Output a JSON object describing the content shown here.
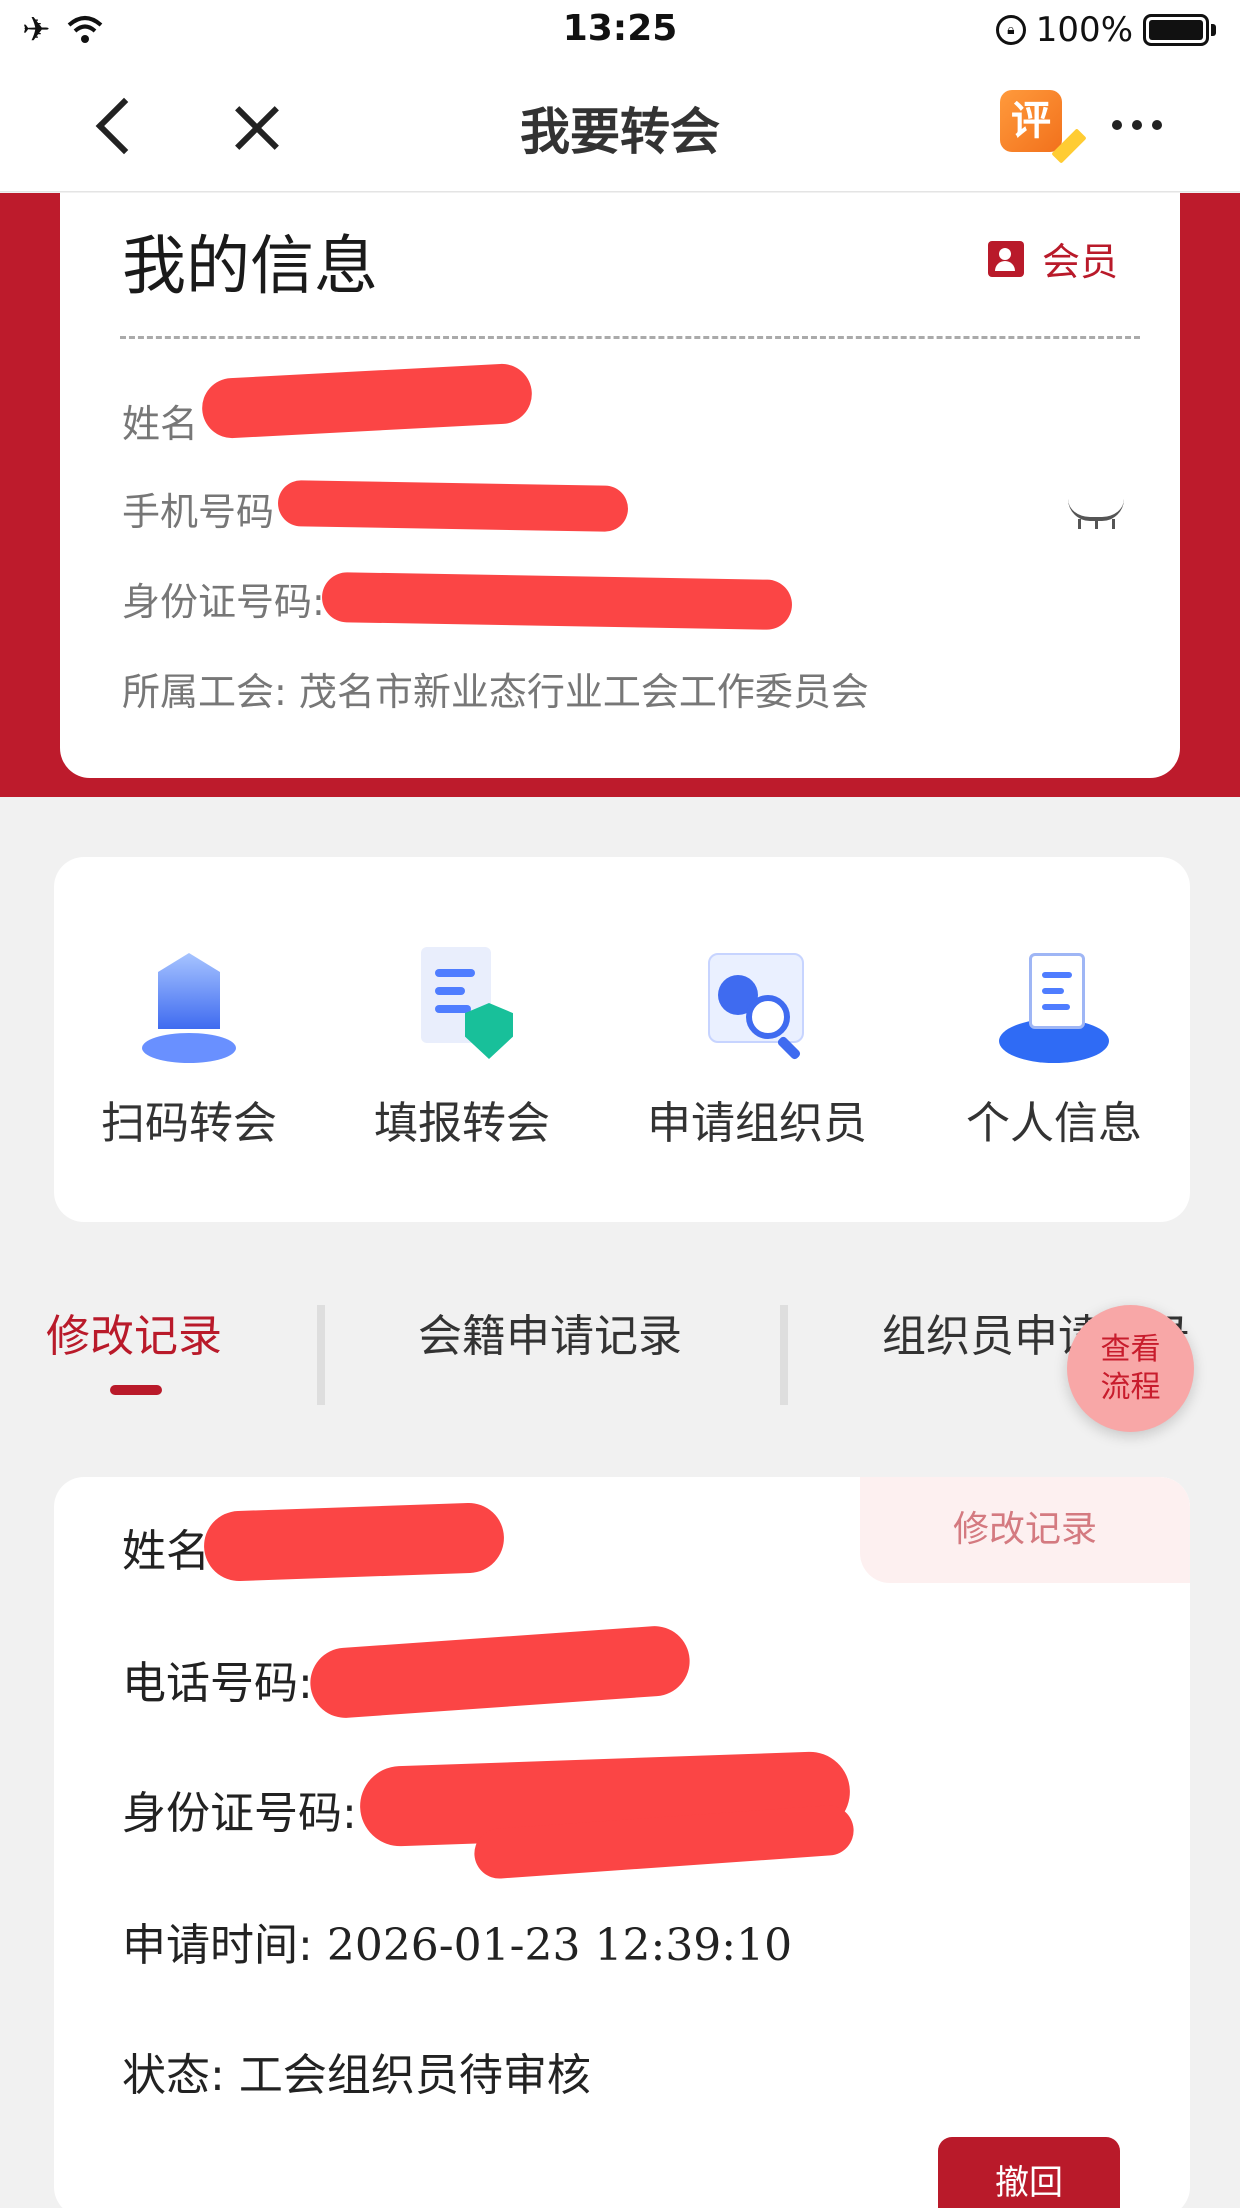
{
  "status_bar": {
    "time": "13:25",
    "battery": "100%",
    "icons": [
      "airplane-icon",
      "wifi-icon",
      "orientation-lock-icon",
      "battery-icon"
    ]
  },
  "nav": {
    "title": "我要转会",
    "rate_icon_text": "评",
    "icons": [
      "back-icon",
      "close-icon",
      "rate-icon",
      "more-icon"
    ]
  },
  "info_card": {
    "title": "我的信息",
    "badge": "会员",
    "fields": {
      "name_label": "姓名",
      "phone_label": "手机号码",
      "id_label": "身份证号码:",
      "union_label": "所属工会:",
      "union_value": "茂名市新业态行业工会工作委员会"
    },
    "phone_visibility": "hidden"
  },
  "actions": [
    {
      "label": "扫码转会",
      "icon": "scan-transfer-icon"
    },
    {
      "label": "填报转会",
      "icon": "fill-transfer-icon"
    },
    {
      "label": "申请组织员",
      "icon": "apply-organizer-icon"
    },
    {
      "label": "个人信息",
      "icon": "personal-info-icon"
    }
  ],
  "tabs": {
    "items": [
      "修改记录",
      "会籍申请记录",
      "组织员申请记录"
    ],
    "active_index": 0
  },
  "fab": {
    "line1": "查看",
    "line2": "流程"
  },
  "record": {
    "tag": "修改记录",
    "name_label": "姓名",
    "phone_label": "电话号码:",
    "id_label": "身份证号码:",
    "time_label": "申请时间:",
    "time_value": "2026-01-23 12:39:10",
    "status_label": "状态:",
    "status_value": "工会组织员待审核",
    "revoke_button": "撤回"
  },
  "colors": {
    "brand_red": "#bd1b2c",
    "redaction": "#fb4545",
    "page_bg": "#f1f1f1",
    "tab_active": "#b91a2a"
  }
}
